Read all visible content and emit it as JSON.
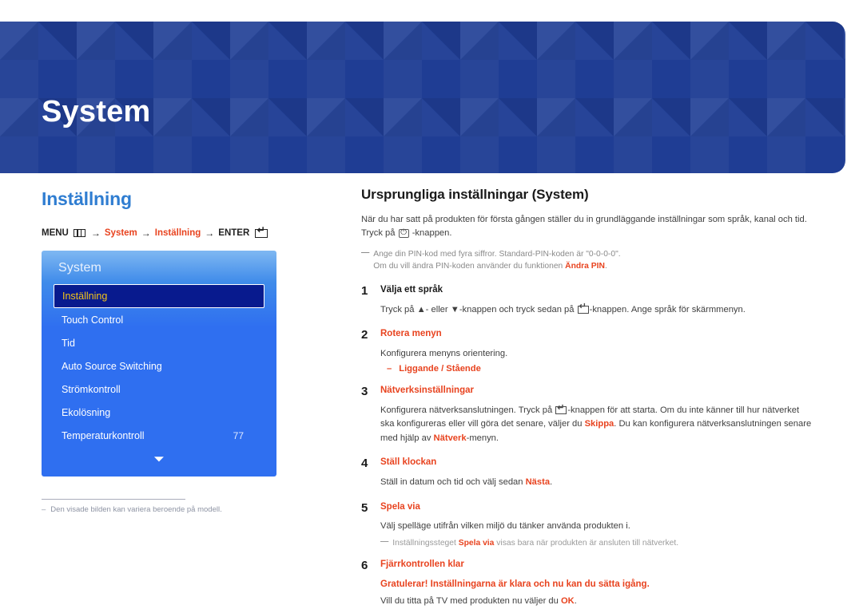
{
  "banner": {
    "title": "System"
  },
  "left": {
    "section_title": "Inställning",
    "breadcrumb": {
      "menu_label": "MENU",
      "menu_icon": "menu-grid-icon",
      "arrow": "→",
      "item1": "System",
      "item2": "Inställning",
      "enter_label": "ENTER",
      "enter_icon": "enter-key-icon"
    },
    "osd": {
      "header": "System",
      "items": [
        {
          "label": "Inställning",
          "value": "",
          "selected": true
        },
        {
          "label": "Touch Control",
          "value": "",
          "selected": false
        },
        {
          "label": "Tid",
          "value": "",
          "selected": false
        },
        {
          "label": "Auto Source Switching",
          "value": "",
          "selected": false
        },
        {
          "label": "Strömkontroll",
          "value": "",
          "selected": false
        },
        {
          "label": "Ekolösning",
          "value": "",
          "selected": false
        },
        {
          "label": "Temperaturkontroll",
          "value": "77",
          "selected": false
        }
      ],
      "scroll_icon": "chevron-down-icon"
    },
    "footnote": {
      "dash": "–",
      "text": "Den visade bilden kan variera beroende på modell."
    }
  },
  "right": {
    "title": "Ursprungliga inställningar (System)",
    "intro_line1": "När du har satt på produkten för första gången ställer du in grundläggande inställningar som språk, kanal och tid.",
    "intro_line2_a": "Tryck på",
    "intro_power_icon": "power-button-icon",
    "intro_line2_b": "-knappen.",
    "note": {
      "dash": "—",
      "line1": "Ange din PIN-kod med fyra siffror. Standard-PIN-koden är \"0-0-0-0\".",
      "line2_a": "Om du vill ändra PIN-koden använder du funktionen",
      "line2_hl": "Ändra PIN",
      "line2_b": "."
    },
    "steps": [
      {
        "num": "1",
        "head": "Välja ett språk",
        "head_highlight": false,
        "text_a": "Tryck på ▲- eller ▼-knappen och tryck sedan på",
        "enter_icon": "enter-key-icon",
        "text_b": "-knappen. Ange språk för skärmmenyn."
      },
      {
        "num": "2",
        "head": "Rotera menyn",
        "head_highlight": true,
        "text_a": "Konfigurera menyns orientering.",
        "bullet_dash": "–",
        "bullet": "Liggande / Stående"
      },
      {
        "num": "3",
        "head": "Nätverksinställningar",
        "head_highlight": true,
        "text_a": "Konfigurera nätverksanslutningen. Tryck på",
        "enter_icon": "enter-key-icon",
        "text_b": "-knappen för att starta. Om du inte känner till hur nätverket ska konfigureras eller vill göra det senare, väljer du",
        "hl1": "Skippa",
        "text_c": ". Du kan konfigurera nätverksanslutningen senare med hjälp av",
        "hl2": "Nätverk",
        "text_d": "-menyn."
      },
      {
        "num": "4",
        "head": "Ställ klockan",
        "head_highlight": true,
        "text_a": "Ställ in datum och tid och välj sedan",
        "hl1": "Nästa",
        "text_b": "."
      },
      {
        "num": "5",
        "head": "Spela via",
        "head_highlight": true,
        "text_a": "Välj spelläge utifrån vilken miljö du tänker använda produkten i.",
        "note_dash": "—",
        "note_a": "Inställningssteget",
        "note_hl": "Spela via",
        "note_b": "visas bara när produkten är ansluten till nätverket."
      },
      {
        "num": "6",
        "head": "Fjärrkontrollen klar",
        "head_highlight": true,
        "final_line": "Gratulerar! Inställningarna är klara och nu kan du sätta igång.",
        "final_sub_a": "Vill du titta på TV med produkten nu väljer du",
        "final_sub_hl": "OK",
        "final_sub_b": "."
      }
    ]
  },
  "colors": {
    "banner_blue": "#1f3d94",
    "section_blue": "#2f7dd1",
    "accent_orange": "#e8431f",
    "osd_blue": "#2f6ff0",
    "osd_selected_bg": "#081a8e",
    "osd_selected_text": "#f5c518"
  }
}
